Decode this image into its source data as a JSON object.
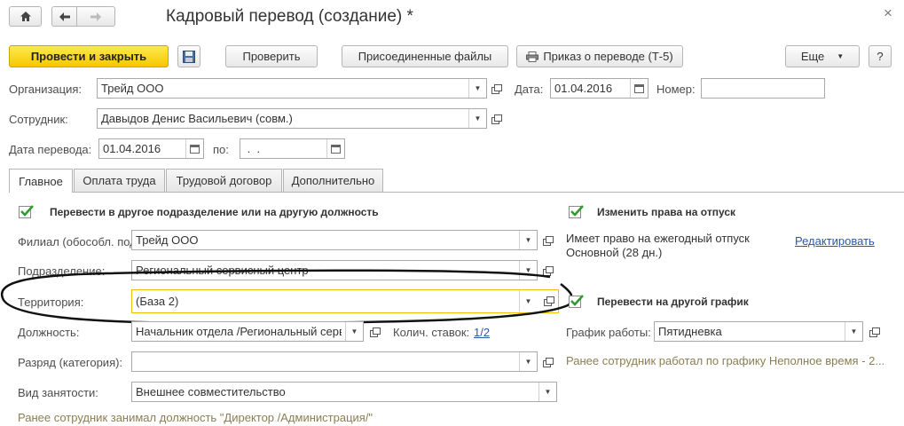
{
  "window": {
    "title": "Кадровый перевод (создание) *",
    "close_glyph": "×"
  },
  "toolbar": {
    "post_close": "Провести и закрыть",
    "check": "Проверить",
    "attached_files": "Присоединенные файлы",
    "order": "Приказ о переводе (Т-5)",
    "more": "Еще",
    "help": "?"
  },
  "header": {
    "org_label": "Организация:",
    "org_value": "Трейд ООО",
    "date_label": "Дата:",
    "date_value": "01.04.2016",
    "number_label": "Номер:",
    "number_value": "",
    "employee_label": "Сотрудник:",
    "employee_value": "Давыдов Денис Васильевич (совм.)",
    "transfer_date_label": "Дата перевода:",
    "transfer_date_value": "01.04.2016",
    "to_label": "по:",
    "to_value": " .  ."
  },
  "tabs": [
    {
      "label": "Главное",
      "active": true
    },
    {
      "label": "Оплата труда",
      "active": false
    },
    {
      "label": "Трудовой договор",
      "active": false
    },
    {
      "label": "Дополнительно",
      "active": false
    }
  ],
  "main": {
    "transfer_check_label": "Перевести в другое подразделение или на другую должность",
    "branch_label": "Филиал (обособл. подр.):",
    "branch_value": "Трейд ООО",
    "dept_label": "Подразделение:",
    "dept_value": "Региональный сервисный центр",
    "territory_label": "Территория:",
    "territory_value": "(База 2)",
    "position_label": "Должность:",
    "position_value": "Начальник отдела /Региональный серв",
    "rate_label": "Колич. ставок:",
    "rate_value": "1/2",
    "grade_label": "Разряд (категория):",
    "grade_value": "",
    "employment_label": "Вид занятости:",
    "employment_value": "Внешнее совместительство",
    "prev_position_note": "Ранее сотрудник занимал должность \"Директор /Администрация/\""
  },
  "right": {
    "vacation_check_label": "Изменить права на отпуск",
    "vacation_text_1": "Имеет право на ежегодный отпуск",
    "vacation_text_2": "Основной (28 дн.)",
    "edit_link": "Редактировать",
    "schedule_check_label": "Перевести на другой график",
    "schedule_label": "График работы:",
    "schedule_value": "Пятидневка",
    "prev_schedule_note": "Ранее сотрудник работал по графику Неполное время - 2..."
  },
  "colors": {
    "accent_yellow": "#f5c700",
    "note_color": "#8b7e52",
    "link_color": "#2a5aa7",
    "check_green": "#2e9b2e"
  }
}
